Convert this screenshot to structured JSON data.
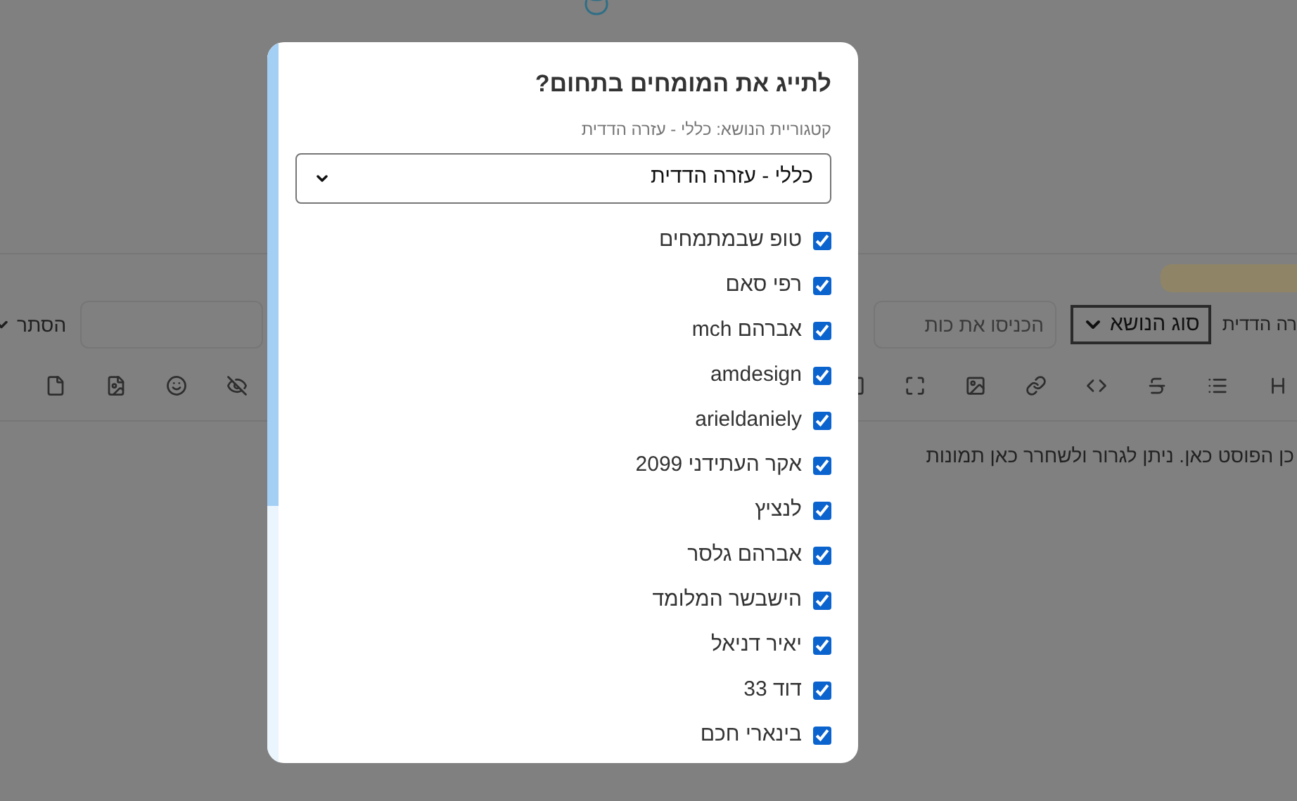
{
  "background": {
    "visibility_dropdown": {
      "label": "הסתר"
    },
    "title_field": {
      "placeholder": "הכניסו את כות"
    },
    "topic_type_select": {
      "label": "סוג הנושא"
    },
    "category_text": "רה הדדית",
    "editor": {
      "placeholder": "כן הפוסט כאן. ניתן לגרור ולשחרר כאן תמונות"
    }
  },
  "modal": {
    "title": "לתייג את המומחים בתחום?",
    "subtitle": "קטגוריית הנושא: כללי - עזרה הדדית",
    "category_select": {
      "value": "כללי - עזרה הדדית"
    },
    "experts": [
      {
        "name": "טופ שבמתמחים",
        "checked": true
      },
      {
        "name": "רפי סאם",
        "checked": true
      },
      {
        "name": "אברהם mch",
        "checked": true
      },
      {
        "name": "amdesign",
        "checked": true
      },
      {
        "name": "arieldaniely",
        "checked": true
      },
      {
        "name": "אקר העתידני 2099",
        "checked": true
      },
      {
        "name": "לנציץ",
        "checked": true
      },
      {
        "name": "אברהם גלסר",
        "checked": true
      },
      {
        "name": "הישבשר המלומד",
        "checked": true
      },
      {
        "name": "יאיר דניאל",
        "checked": true
      },
      {
        "name": "דוד 33",
        "checked": true
      },
      {
        "name": "בינארי חכם",
        "checked": true
      }
    ]
  }
}
